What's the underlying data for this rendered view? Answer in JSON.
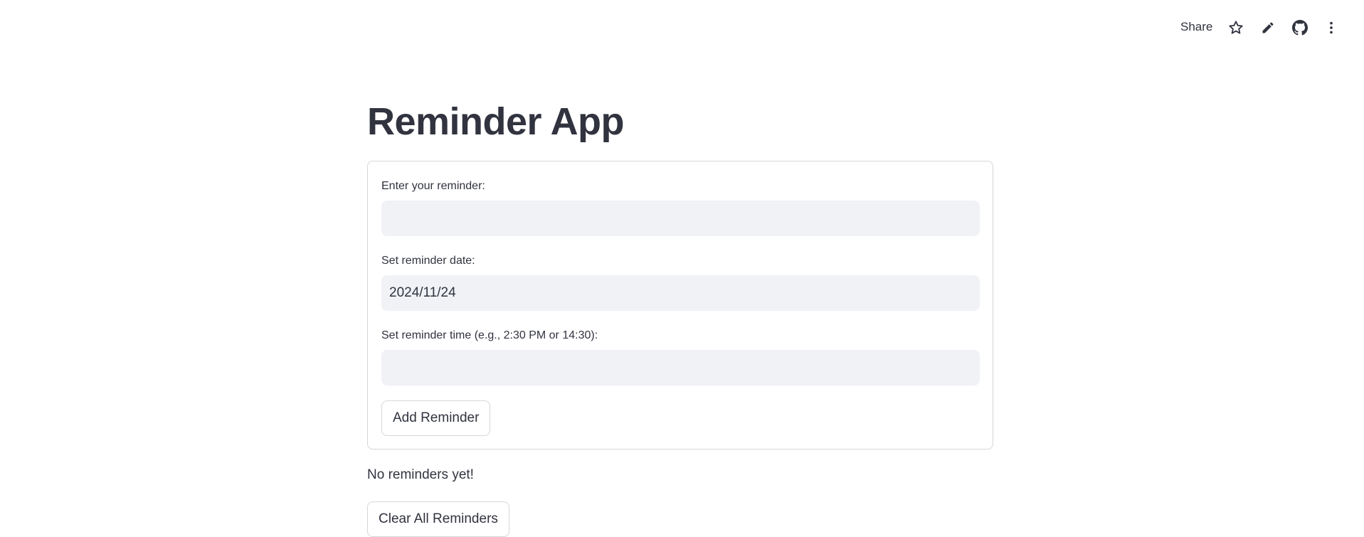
{
  "header": {
    "share_label": "Share",
    "icons": [
      "star-icon",
      "pencil-icon",
      "github-icon",
      "more-vertical-icon"
    ]
  },
  "main": {
    "title": "Reminder App",
    "form": {
      "reminder_label": "Enter your reminder:",
      "reminder_value": "",
      "date_label": "Set reminder date:",
      "date_value": "2024/11/24",
      "time_label": "Set reminder time (e.g., 2:30 PM or 14:30):",
      "time_value": "",
      "add_button_label": "Add Reminder"
    },
    "status_text": "No reminders yet!",
    "clear_button_label": "Clear All Reminders"
  },
  "colors": {
    "text": "#31333f",
    "input_bg": "#f0f2f6",
    "border": "#d6d6d9",
    "background": "#ffffff"
  }
}
